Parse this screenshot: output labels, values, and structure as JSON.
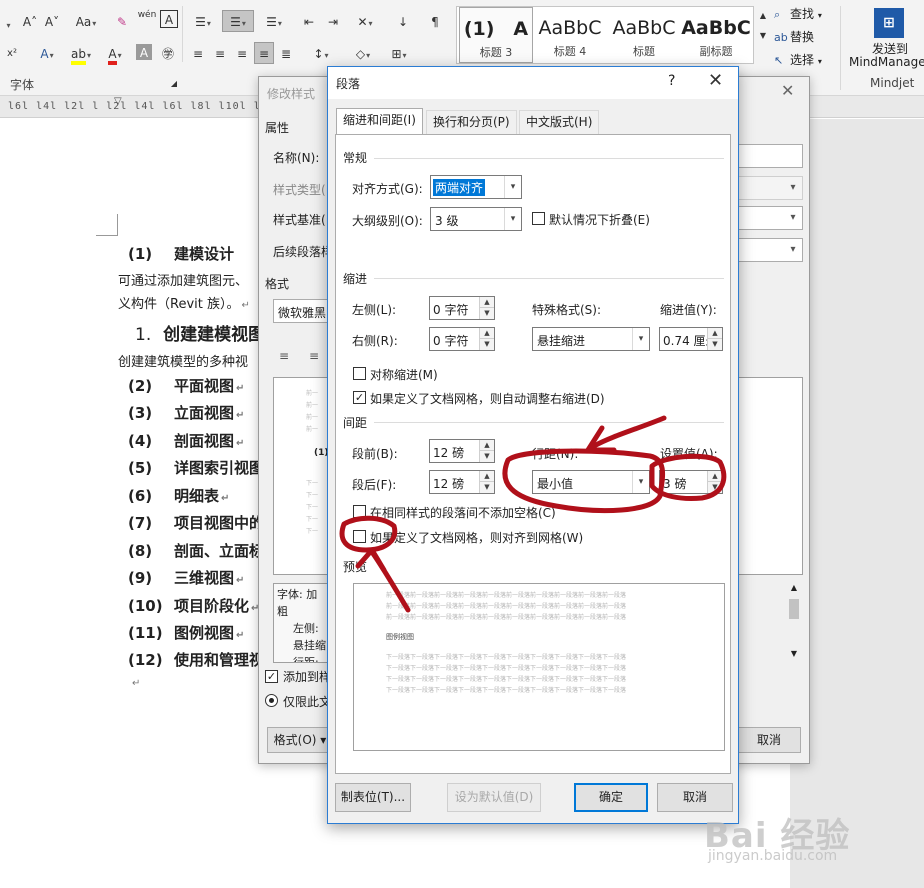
{
  "ribbon": {
    "row1": [
      "A˄",
      "A˅",
      "Aa",
      "清",
      "wén",
      "A",
      "≔",
      "≔",
      "≔",
      "⇤",
      "⇥",
      "✕",
      "↕",
      "¶"
    ],
    "font_group_label": "字体",
    "styles": [
      {
        "sample": "(1)　A",
        "name": "标题 3"
      },
      {
        "sample": "AaBbC",
        "name": "标题 4"
      },
      {
        "sample": "AaBbC",
        "name": "标题"
      },
      {
        "sample": "AaBbC",
        "name": "副标题"
      }
    ],
    "editing": {
      "find": "查找",
      "replace": "替换",
      "select": "选择"
    },
    "mindjet": {
      "send": "发送到",
      "target": "MindManager",
      "group": "Mindjet"
    }
  },
  "ruler": {
    "ticks": "l6l  l4l  l2l  l       l2l  l4l  l6l  l8l  l10l  l12l  l14l  l16l  l18l  l20l  l22l  l24l  l26l  l28l  l30l  l32l  l34l  l36l  l38l  l40l"
  },
  "document": {
    "heading1": {
      "num": "(1)",
      "text": "建模设计"
    },
    "para1a": "可通过添加建筑图元、",
    "para1b": "义构件（Revit 族）。",
    "heading2": {
      "num": "1.",
      "text": "创建建模视图"
    },
    "para2": "创建建筑模型的多种视",
    "items": [
      {
        "num": "(2)",
        "text": "平面视图"
      },
      {
        "num": "(3)",
        "text": "立面视图"
      },
      {
        "num": "(4)",
        "text": "剖面视图"
      },
      {
        "num": "(5)",
        "text": "详图索引视图"
      },
      {
        "num": "(6)",
        "text": "明细表"
      },
      {
        "num": "(7)",
        "text": "项目视图中的"
      },
      {
        "num": "(8)",
        "text": "剖面、立面标"
      },
      {
        "num": "(9)",
        "text": "三维视图"
      },
      {
        "num": "(10)",
        "text": "项目阶段化"
      },
      {
        "num": "(11)",
        "text": "图例视图"
      },
      {
        "num": "(12)",
        "text": "使用和管理视"
      }
    ],
    "mark": "↵"
  },
  "modify_style": {
    "title": "修改样式",
    "properties": "属性",
    "name_label": "名称(N):",
    "style_type_label": "样式类型(",
    "style_based_label": "样式基准(",
    "following_label": "后续段落样",
    "format_label": "格式",
    "font_value": "微软雅黑",
    "desc": [
      "字体: 加粗",
      "左侧:",
      "悬挂缩",
      "行距: 最"
    ],
    "add_to_gallery": "添加到样",
    "only_this_doc": "仅限此文",
    "format_button": "格式(O) ▾",
    "cancel_button": "取消"
  },
  "paragraph": {
    "title": "段落",
    "help": "?",
    "tabs": [
      "缩进和间距(I)",
      "换行和分页(P)",
      "中文版式(H)"
    ],
    "general": "常规",
    "alignment_label": "对齐方式(G):",
    "alignment_value": "两端对齐",
    "outline_label": "大纲级别(O):",
    "outline_value": "3 级",
    "collapse_label": "默认情况下折叠(E)",
    "indent": "缩进",
    "left_label": "左侧(L):",
    "left_value": "0 字符",
    "right_label": "右侧(R):",
    "right_value": "0 字符",
    "special_label": "特殊格式(S):",
    "special_value": "悬挂缩进",
    "indent_by_label": "缩进值(Y):",
    "indent_by_value": "0.74 厘米",
    "mirror_label": "对称缩进(M)",
    "auto_right_label": "如果定义了文档网格，则自动调整右缩进(D)",
    "spacing": "间距",
    "before_label": "段前(B):",
    "before_value": "12 磅",
    "after_label": "段后(F):",
    "after_value": "12 磅",
    "line_spacing_label": "行距(N):",
    "line_spacing_value": "最小值",
    "at_label": "设置值(A):",
    "at_value": "3 磅",
    "no_space_label": "在相同样式的段落间不添加空格(C)",
    "snap_grid_label": "如果定义了文档网格，则对齐到网格(W)",
    "preview": "预览",
    "preview_prev": "前一段落前一段落前一段落前一段落前一段落前一段落前一段落前一段落前一段落前一段落",
    "preview_current": "图例视图",
    "preview_next": "下一段落下一段落下一段落下一段落下一段落下一段落下一段落下一段落下一段落下一段落",
    "tabs_button": "制表位(T)...",
    "default_button": "设为默认值(D)",
    "ok_button": "确定",
    "cancel_button": "取消"
  },
  "watermark": {
    "brand": "Bai 经验",
    "url": "jingyan.baidu.com"
  },
  "annotation_color": "#b0101a"
}
